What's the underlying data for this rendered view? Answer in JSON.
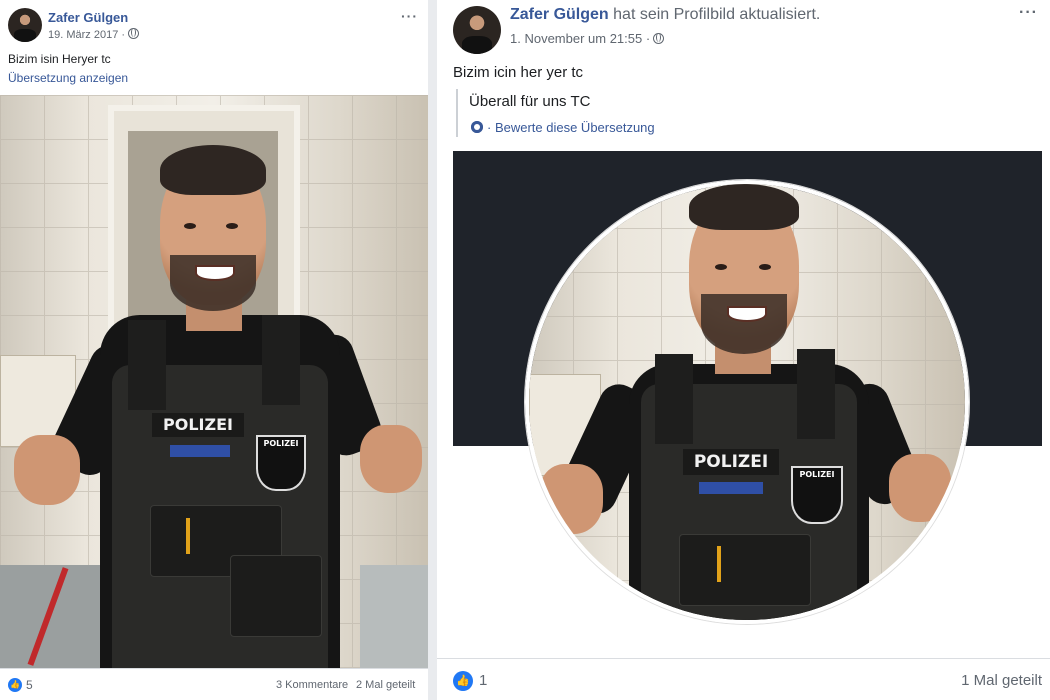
{
  "left_post": {
    "author": "Zafer Gülgen",
    "date": "19. März 2017 ·",
    "text": "Bizim isin Heryer tc",
    "translate_link": "Übersetzung anzeigen",
    "patch_text": "POLIZEI",
    "badge_text": "POLIZEI",
    "reactions_count": "5",
    "comments": "3 Kommentare",
    "shares": "2 Mal geteilt"
  },
  "right_post": {
    "author": "Zafer Gülgen",
    "action": "hat sein Profilbild aktualisiert.",
    "date": "1. November um 21:55 ·",
    "text": "Bizim icin her yer tc",
    "translation": "Überall für uns TC",
    "rate_translation": "· Bewerte diese Übersetzung",
    "patch_text": "POLIZEI",
    "badge_text": "POLIZEI",
    "reactions_count": "1",
    "shares": "1 Mal geteilt"
  },
  "more_label": "···",
  "like_glyph": "👍",
  "colors": {
    "link": "#385898",
    "like": "#2078f4",
    "banner": "#1f232a"
  }
}
